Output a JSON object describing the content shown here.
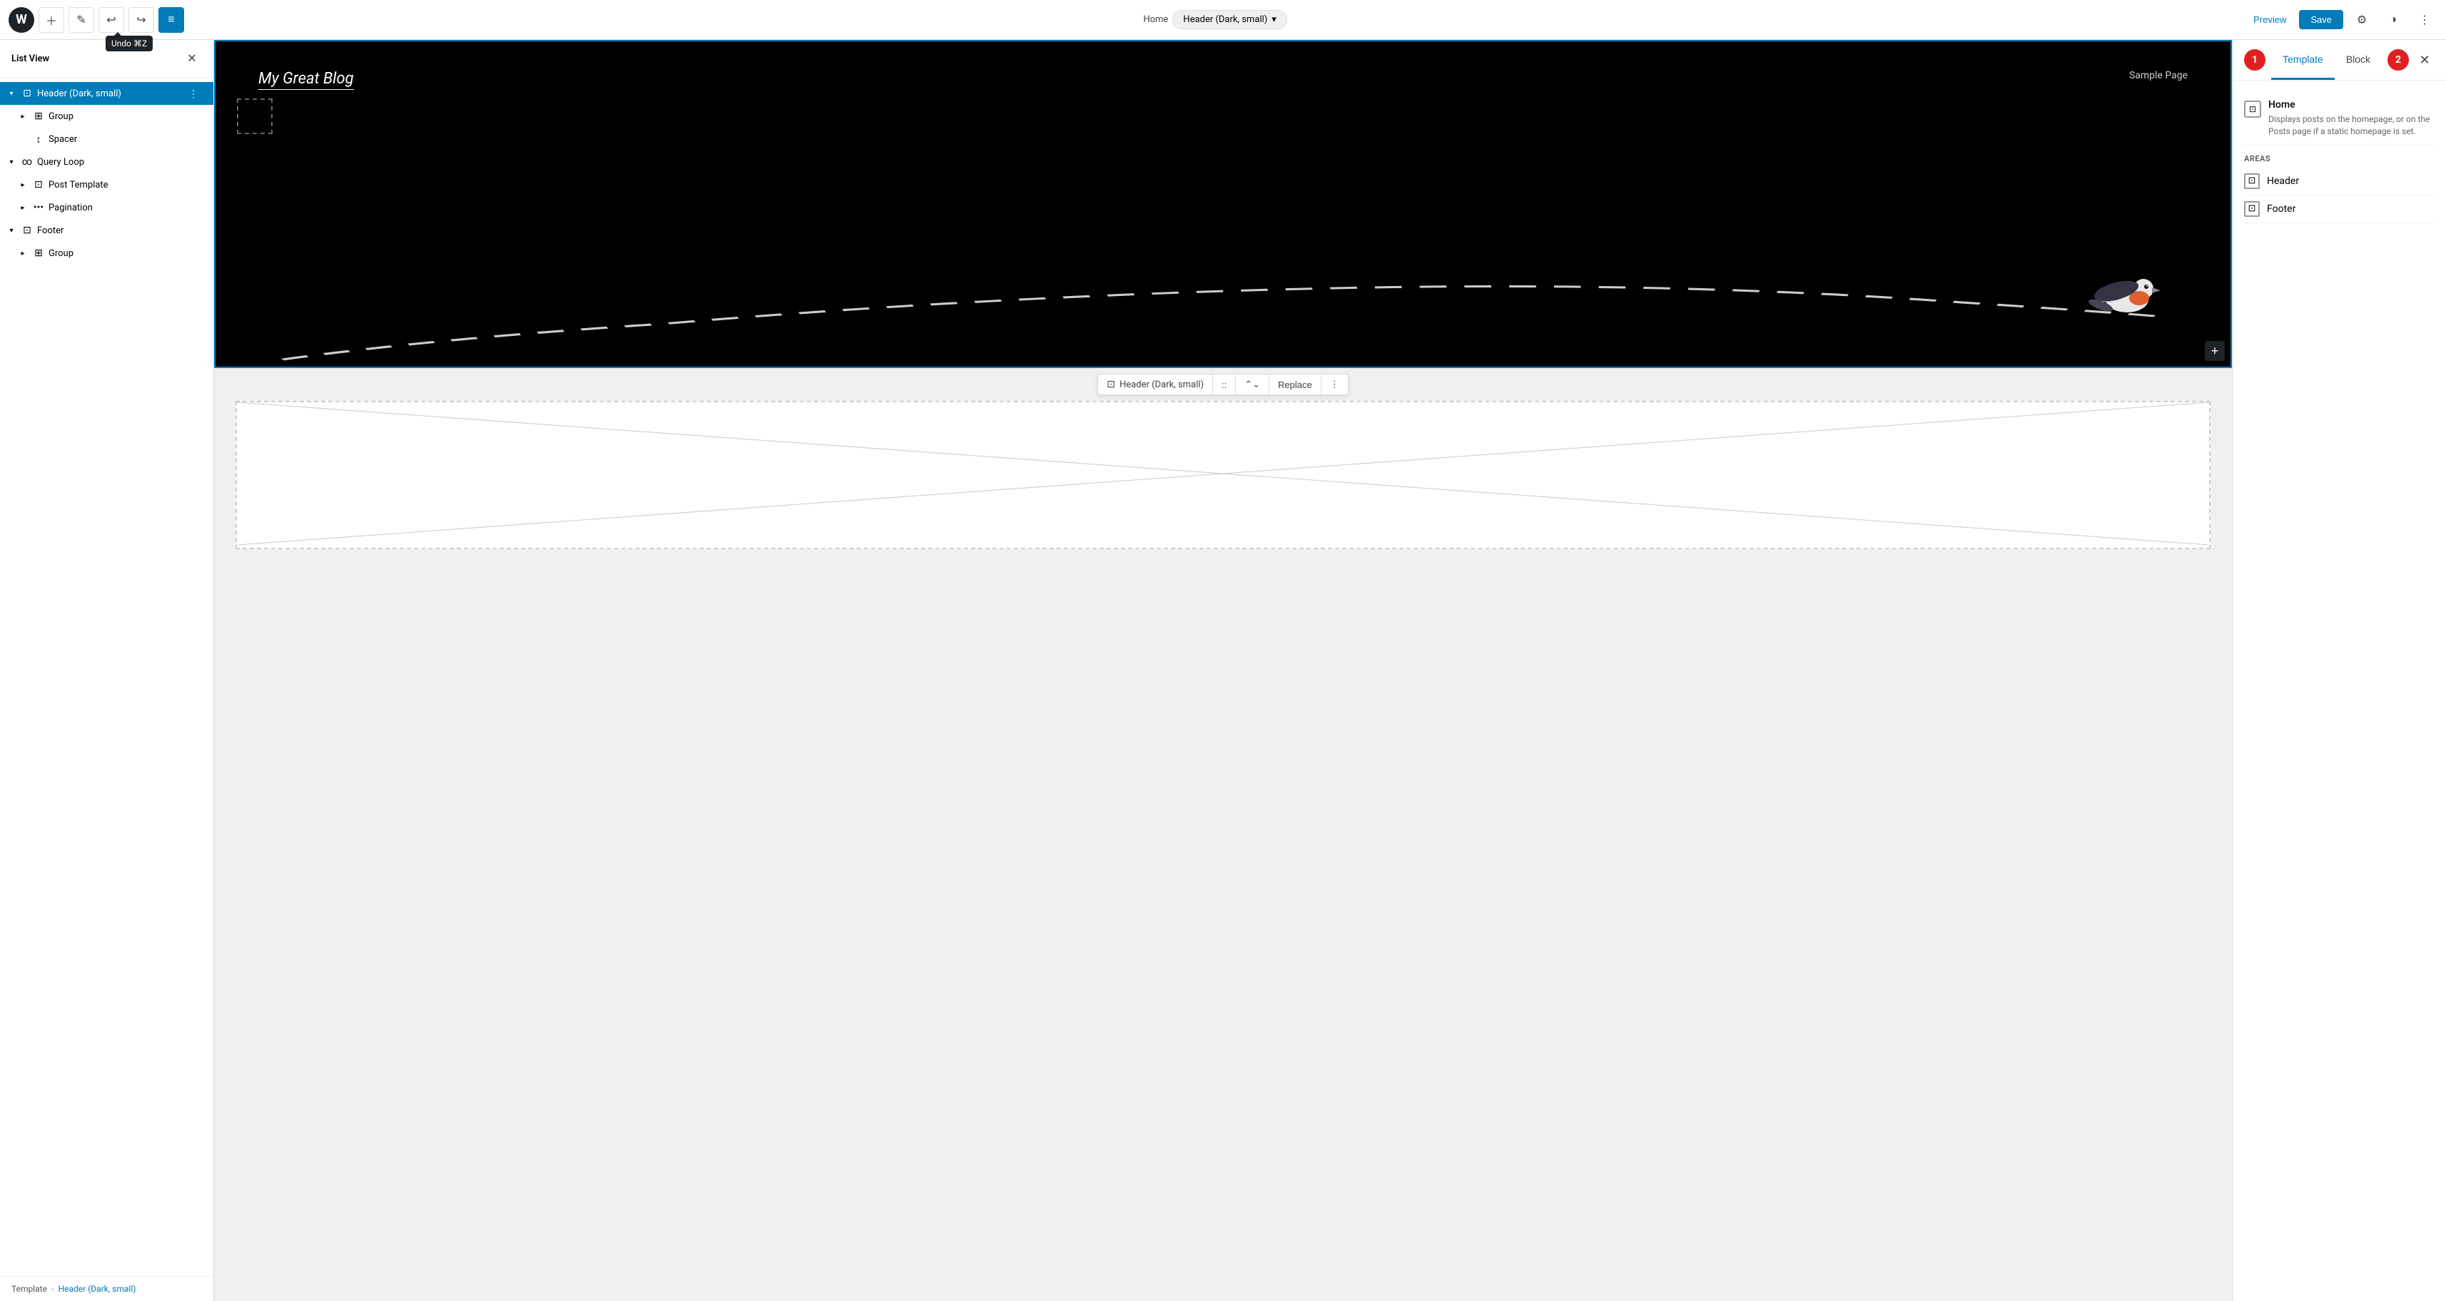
{
  "toolbar": {
    "undo_label": "Undo",
    "undo_shortcut": "⌘Z",
    "preview_label": "Preview",
    "save_label": "Save",
    "breadcrumb_home": "Home",
    "breadcrumb_current": "Header (Dark, small)",
    "list_view_label": "List View"
  },
  "sidebar": {
    "title": "List View",
    "items": [
      {
        "id": "header",
        "label": "Header (Dark, small)",
        "level": 0,
        "chevron": "open",
        "icon": "🗋",
        "selected": true
      },
      {
        "id": "group1",
        "label": "Group",
        "level": 1,
        "chevron": "closed",
        "icon": "▦"
      },
      {
        "id": "spacer",
        "label": "Spacer",
        "level": 1,
        "chevron": "leaf",
        "icon": "↕"
      },
      {
        "id": "queryloop",
        "label": "Query Loop",
        "level": 0,
        "chevron": "open",
        "icon": "∞"
      },
      {
        "id": "posttemplate",
        "label": "Post Template",
        "level": 1,
        "chevron": "closed",
        "icon": "🗋"
      },
      {
        "id": "pagination",
        "label": "Pagination",
        "level": 1,
        "chevron": "closed",
        "icon": "…"
      },
      {
        "id": "footer",
        "label": "Footer",
        "level": 0,
        "chevron": "open",
        "icon": "🗋"
      },
      {
        "id": "group2",
        "label": "Group",
        "level": 1,
        "chevron": "closed",
        "icon": "▦"
      }
    ],
    "footer_template": "Template",
    "footer_sep": "›",
    "footer_current": "Header (Dark, small)"
  },
  "canvas": {
    "blog_title": "My Great Blog",
    "sample_page": "Sample Page",
    "block_toolbar": {
      "block_icon": "🗋",
      "block_name": "Header (Dark, small)",
      "replace_label": "Replace",
      "more_label": "⋮"
    }
  },
  "right_panel": {
    "step1_label": "1",
    "step2_label": "2",
    "tab_template": "Template",
    "tab_block": "Block",
    "close_label": "✕",
    "template_name": "Home",
    "template_desc": "Displays posts on the homepage, or on the Posts page if a static homepage is set.",
    "areas_label": "AREAS",
    "areas": [
      {
        "name": "Header"
      },
      {
        "name": "Footer"
      }
    ]
  }
}
